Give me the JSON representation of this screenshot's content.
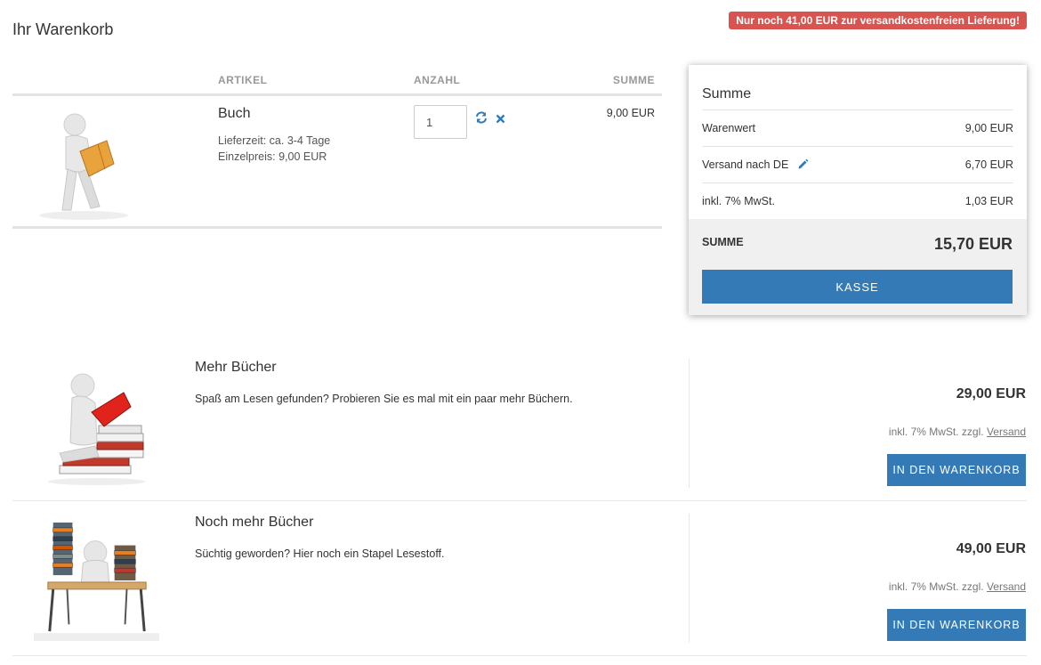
{
  "page": {
    "title": "Ihr Warenkorb"
  },
  "badge": {
    "text": "Nur noch 41,00 EUR zur versandkostenfreien Lieferung!"
  },
  "cart": {
    "headers": {
      "artikel": "ARTIKEL",
      "anzahl": "ANZAHL",
      "summe": "SUMME"
    },
    "items": [
      {
        "name": "Buch",
        "lieferzeit": "Lieferzeit: ca. 3-4 Tage",
        "einzelpreis": "Einzelpreis: 9,00 EUR",
        "quantity": "1",
        "sum": "9,00 EUR"
      }
    ]
  },
  "summary": {
    "title": "Summe",
    "lines": [
      {
        "label": "Warenwert",
        "value": "9,00 EUR"
      },
      {
        "label": "Versand nach DE",
        "value": "6,70 EUR"
      },
      {
        "label": "inkl. 7% MwSt.",
        "value": "1,03 EUR"
      }
    ],
    "total_label": "SUMME",
    "total_value": "15,70 EUR",
    "checkout_label": "KASSE"
  },
  "products": [
    {
      "name": "Mehr Bücher",
      "description": "Spaß am Lesen gefunden? Probieren Sie es mal mit ein paar mehr Büchern.",
      "price": "29,00 EUR",
      "tax_note": "inkl. 7% MwSt. zzgl.",
      "shipping_link": "Versand",
      "button": "IN DEN WARENKORB"
    },
    {
      "name": "Noch mehr Bücher",
      "description": "Süchtig geworden? Hier noch ein Stapel Lesestoff.",
      "price": "49,00 EUR",
      "tax_note": "inkl. 7% MwSt. zzgl.",
      "shipping_link": "Versand",
      "button": "IN DEN WARENKORB"
    }
  ],
  "colors": {
    "primary": "#337ab7",
    "badge": "#d9534f",
    "remove": "#337ab7"
  },
  "icons": {
    "refresh": "refresh-icon",
    "remove": "close-icon",
    "edit": "pencil-icon"
  }
}
